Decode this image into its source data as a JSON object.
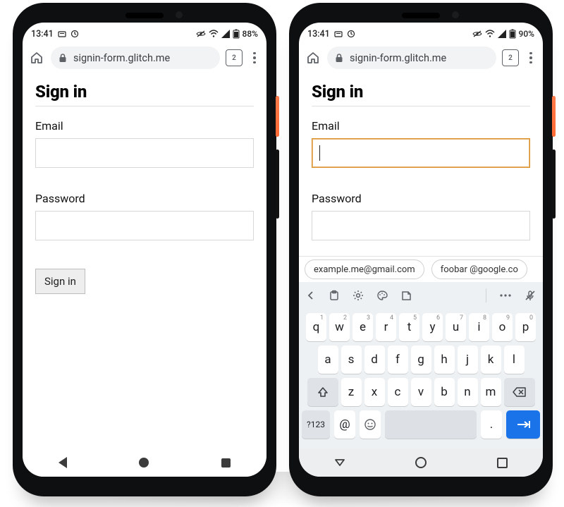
{
  "left": {
    "status": {
      "time": "13:41",
      "battery": "88%"
    },
    "browser": {
      "url": "signin-form.glitch.me",
      "tab_count": "2"
    },
    "page": {
      "title": "Sign in",
      "email_label": "Email",
      "email_value": "",
      "password_label": "Password",
      "password_value": "",
      "submit_label": "Sign in"
    }
  },
  "right": {
    "status": {
      "time": "13:41",
      "battery": "90%"
    },
    "browser": {
      "url": "signin-form.glitch.me",
      "tab_count": "2"
    },
    "page": {
      "title": "Sign in",
      "email_label": "Email",
      "email_value": "",
      "password_label": "Password",
      "password_value": "",
      "submit_label": "Sign in"
    },
    "suggestions": [
      "example.me@gmail.com",
      "foobar @google.co"
    ],
    "keyboard": {
      "row1": [
        {
          "main": "q",
          "sup": "1"
        },
        {
          "main": "w",
          "sup": "2"
        },
        {
          "main": "e",
          "sup": "3"
        },
        {
          "main": "r",
          "sup": "4"
        },
        {
          "main": "t",
          "sup": "5"
        },
        {
          "main": "y",
          "sup": "6"
        },
        {
          "main": "u",
          "sup": "7"
        },
        {
          "main": "i",
          "sup": "8"
        },
        {
          "main": "o",
          "sup": "9"
        },
        {
          "main": "p",
          "sup": "0"
        }
      ],
      "row2": [
        "a",
        "s",
        "d",
        "f",
        "g",
        "h",
        "j",
        "k",
        "l"
      ],
      "row3": [
        "z",
        "x",
        "c",
        "v",
        "b",
        "n",
        "m"
      ],
      "sym_label": "?123",
      "at_label": "@",
      "dot_label": "."
    }
  }
}
